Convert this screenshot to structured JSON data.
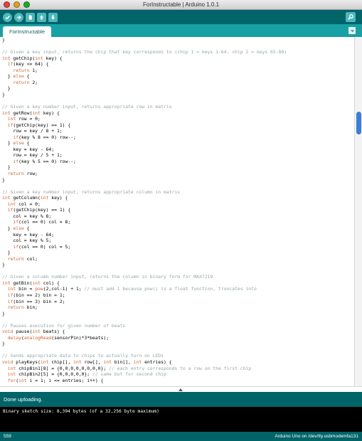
{
  "window": {
    "title": "ForInstructable | Arduino 1.0.1"
  },
  "toolbar": {
    "buttons": [
      {
        "name": "verify-button",
        "icon": "checkmark-icon"
      },
      {
        "name": "upload-button",
        "icon": "arrow-right-icon"
      },
      {
        "name": "new-button",
        "icon": "new-file-icon"
      },
      {
        "name": "open-button",
        "icon": "arrow-up-icon"
      },
      {
        "name": "save-button",
        "icon": "arrow-down-icon"
      }
    ],
    "serial_icon": "magnifier-icon"
  },
  "tab": {
    "label": "ForInstructable"
  },
  "colors": {
    "toolbar_bg": "#006468",
    "tabbar_bg": "#17a1a5",
    "button_bg": "#4db7bb",
    "keyword": "#cc6633",
    "comment": "#95a5a6",
    "scroll_thumb": "#3a7fd5"
  },
  "code": [
    "}",
    "",
    "// Given a key input, returns the chip that key corresponds to (chip 1 = keys 1-64, chip 2 = keys 65-88)",
    "int getChip(int key) {",
    "  if(key <= 64) {",
    "    return 1;",
    "  } else {",
    "    return 2;",
    "  }",
    "}",
    "",
    "// Given a key number input, returns appropriate row in matrix",
    "int getRow(int key) {",
    "  int row = 0;",
    "  if(getChip(key) == 1) {",
    "    row = key / 8 + 1;",
    "    if(key % 8 == 0) row--;",
    "  } else {",
    "    key = key - 64;",
    "    row = key / 5 + 1;",
    "    if(key % 5 == 0) row--;",
    "  }",
    "  return row;",
    "}",
    "",
    "// Given a key number input, returns appropriate column in matrix",
    "int getColumn(int key) {",
    "  int col = 0;",
    "  if(getChip(key) == 1) {",
    "    col = key % 8;",
    "    if(col == 0) col = 8;",
    "  } else {",
    "    key = key - 64;",
    "    col = key % 5;",
    "    if(col == 0) col = 5;",
    "  }",
    "  return col;",
    "}",
    "",
    "// Given a column number input, returns the column in binary form for MAX7219",
    "int getBin(int col) {",
    "  int bin = pow(2,col-1) + 1; // must add 1 because pow() is a float function, truncates into",
    "  if(bin == 2) bin = 1;",
    "  if(bin == 3) bin = 2;",
    "  return bin;",
    "}",
    "",
    "// Pauses execution for given number of beats",
    "void pause(int beats) {",
    "  delay(analogRead(sensorPin)*3*beats);",
    "}",
    "",
    "// Sends appropriate data to chips to actually turn on LEDs",
    "void playKeys(int chip[], int row[], int bin[], int entries) {",
    "  int chipBin1[8] = {0,0,0,0,0,0,0,0}; // each entry corresponds to a row on the first chip",
    "  int chipBin2[5] = {0,0,0,0,0}; // same but for second chip",
    "  for(int i = 1; i <= entries; i++) {"
  ],
  "status": {
    "message": "Done uploading."
  },
  "console": {
    "line": "Binary sketch size: 8,394 bytes (of a 32,256 byte maximum)"
  },
  "footer": {
    "line_number": "559",
    "board": "Arduino Uno on /dev/tty.usbmodemfa131"
  }
}
